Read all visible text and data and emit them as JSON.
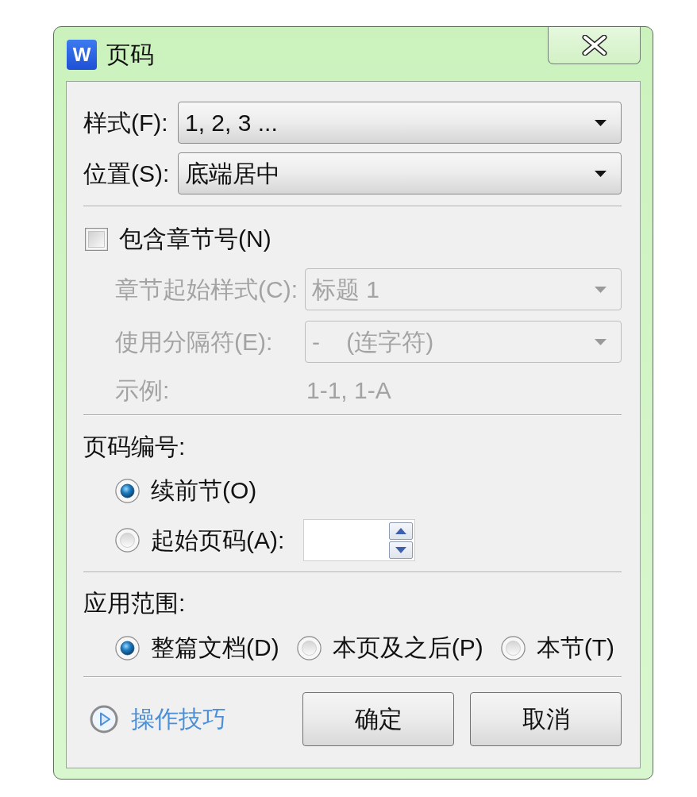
{
  "window": {
    "icon_letter": "W",
    "title": "页码"
  },
  "style_field": {
    "label": "样式(F):",
    "value": "1, 2, 3 ..."
  },
  "position_field": {
    "label": "位置(S):",
    "value": "底端居中"
  },
  "include_chapter": {
    "label": "包含章节号(N)",
    "checked": false
  },
  "chapter_fields": [
    {
      "label": "章节起始样式(C):",
      "value": "标题 1",
      "disabled": true
    },
    {
      "label": "使用分隔符(E):",
      "value": "-    (连字符)",
      "disabled": true
    }
  ],
  "example": {
    "label": "示例:",
    "value": "1-1, 1-A",
    "disabled": true
  },
  "numbering": {
    "heading": "页码编号:",
    "options": [
      {
        "label": "续前节(O)",
        "selected": true,
        "kind": "plain"
      },
      {
        "label": "起始页码(A):",
        "selected": false,
        "kind": "spin"
      }
    ]
  },
  "scope": {
    "heading": "应用范围:",
    "options": [
      {
        "label": "整篇文档(D)",
        "selected": true
      },
      {
        "label": "本页及之后(P)",
        "selected": false
      },
      {
        "label": "本节(T)",
        "selected": false
      }
    ]
  },
  "tips_link": "操作技巧",
  "buttons": [
    "确定",
    "取消"
  ]
}
